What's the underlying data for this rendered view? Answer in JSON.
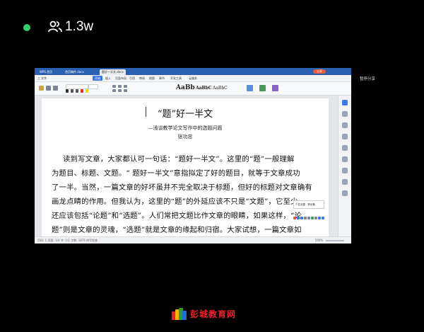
{
  "stream": {
    "viewer_count": "1.3w",
    "status_color": "#2fd06a"
  },
  "side_label": "暂停分享",
  "app": {
    "tabs": [
      {
        "label": "WPS 首页"
      },
      {
        "label": "首页稿件.docx"
      },
      {
        "label": "题好一半文.docx"
      }
    ],
    "share_label": "分享",
    "menu": [
      {
        "label": "三 文件"
      },
      {
        "label": "开始"
      },
      {
        "label": "插入"
      },
      {
        "label": "页面布局"
      },
      {
        "label": "引用"
      },
      {
        "label": "审阅"
      },
      {
        "label": "视图"
      },
      {
        "label": "章节"
      },
      {
        "label": "开发工具"
      },
      {
        "label": "云服务"
      }
    ],
    "style_samples": [
      "AaBb",
      "AaBbC",
      "AaBbC"
    ]
  },
  "document": {
    "title": "“题”好一半文",
    "subtitle": "—浅谈教学论文写作中的选题问题",
    "author": "张功忠",
    "lines": [
      "读到写文章，大家都认可一句话：“题好一半文”。这里的“题”一般理解",
      "为题目、标题、文题。“ 题好一半文”意指拟定了好的题目，就等于文章成功",
      "了一半。当然，一篇文章的好坏虽并不完全取决于标题，但好的标题对文章确有",
      "画龙点睛的作用。但我认为，这里的“题”的外延应该不只是“文题”，它至少",
      "还应该包括“论题”和“选题”。人们常把文题比作文章的眼睛，如果这样，“论",
      "题”则是文章的灵魂，“选题”就是文章的缘起和归宿。大家试想，一篇文章如"
    ],
    "popup_text": "个性设置 · 跨设备"
  },
  "status": {
    "left": "页码: 1  页面: 1/4  节: 1/1  字数: 1876  拼写检查",
    "right": "100%"
  },
  "watermark": {
    "text": "彭城教育网",
    "color": "#e8212b"
  }
}
